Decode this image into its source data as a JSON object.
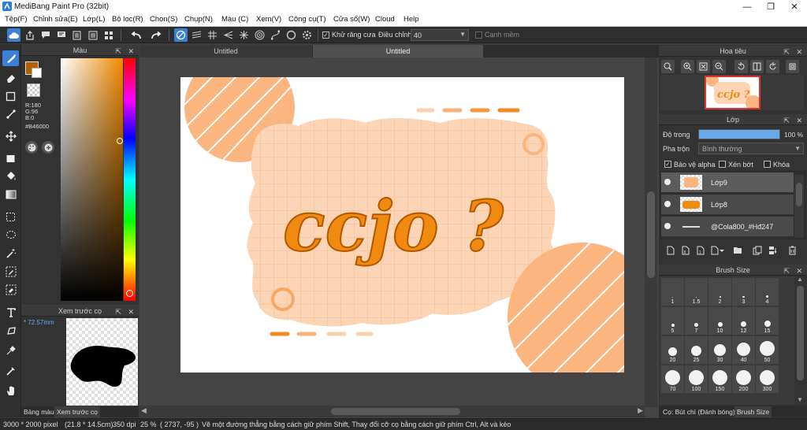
{
  "window": {
    "title": "MediBang Paint Pro (32bit)"
  },
  "menu": [
    "Tệp(F)",
    "Chỉnh sửa(E)",
    "Lớp(L)",
    "Bộ lọc(R)",
    "Chọn(S)",
    "Chụp(N)",
    "Màu (C)",
    "Xem(V)",
    "Công cụ(T)",
    "Cửa sổ(W)",
    "Cloud",
    "Help"
  ],
  "toolbar": {
    "antialias_label": "Khử răng cưa",
    "antialias_checked": "✓",
    "correction_label": "Điều chỉnh",
    "correction_value": "40",
    "edge_label": "Cạnh mềm"
  },
  "color_panel": {
    "title": "Màu",
    "r": "R:180",
    "g": "G:96",
    "b": "B:0",
    "hex": "#B46000",
    "primary_color": "#b46000"
  },
  "brush_preview": {
    "title": "Xem trước cọ",
    "size": "* 72.57mm"
  },
  "left_tabs": {
    "color": "Bảng màu",
    "preview": "Xem trước cọ"
  },
  "documents": {
    "tab1": "Untitled",
    "tab2": "Untitled"
  },
  "canvas": {
    "artwork_text": "ccjo ?"
  },
  "navigator": {
    "title": "Hoa tiêu"
  },
  "layer_panel": {
    "title": "Lớp",
    "opacity_label": "Độ trong",
    "opacity_value": "100 %",
    "opacity_fraction": 1.0,
    "blend_label": "Pha trộn",
    "blend_value": "Bình thường",
    "protect_alpha": "Bảo vệ alpha",
    "clipping": "Xén bớt",
    "lock": "Khóa",
    "check_mark": "✓",
    "layers": [
      {
        "name": "Lớp9"
      },
      {
        "name": "Lớp8"
      },
      {
        "name": "@Cola800_#Hđ247"
      }
    ]
  },
  "brush_size": {
    "title": "Brush Size",
    "sizes": [
      "1",
      "1.5",
      "2",
      "3",
      "4",
      "5",
      "7",
      "10",
      "12",
      "15",
      "20",
      "25",
      "30",
      "40",
      "50",
      "70",
      "100",
      "150",
      "200",
      "300"
    ]
  },
  "right_tabs": {
    "brush": "Cọ: Bút chì (Đánh bóng)",
    "size": "Brush Size"
  },
  "status": {
    "size": "3000 * 2000 pixel",
    "cm": "(21.8 * 14.5cm)",
    "dpi": "350 dpi",
    "zoom": "25 %",
    "coords": "( 2737, -95 )",
    "hint": "Vẽ một đường thẳng bằng cách giữ phím Shift, Thay đổi cỡ cọ bằng cách giữ phím Ctrl, Alt và kéo"
  }
}
